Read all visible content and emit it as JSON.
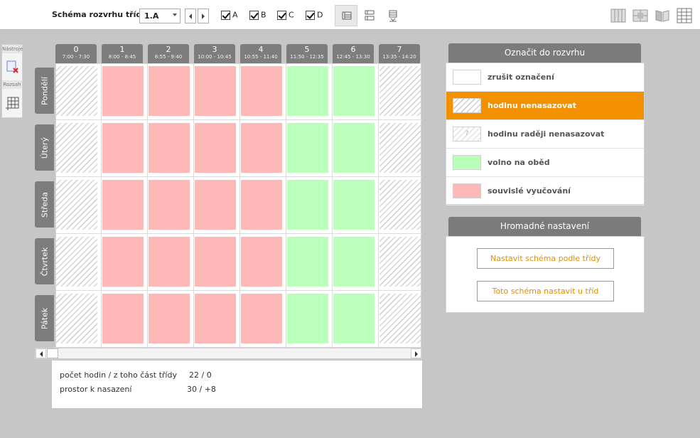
{
  "toolbar": {
    "label": "Schéma rozvrhu třídy:",
    "class_select": "1.A",
    "checks": [
      {
        "label": "A",
        "checked": true
      },
      {
        "label": "B",
        "checked": true
      },
      {
        "label": "C",
        "checked": true
      },
      {
        "label": "D",
        "checked": true
      }
    ]
  },
  "side": {
    "tools_label": "Nástroje",
    "range_label": "Rozsah"
  },
  "columns": [
    {
      "num": "0",
      "time": "7:00 - 7:30"
    },
    {
      "num": "1",
      "time": "8:00 - 8:45"
    },
    {
      "num": "2",
      "time": "8:55 - 9:40"
    },
    {
      "num": "3",
      "time": "10:00 - 10:45"
    },
    {
      "num": "4",
      "time": "10:55 - 11:40"
    },
    {
      "num": "5",
      "time": "11:50 - 12:35"
    },
    {
      "num": "6",
      "time": "12:45 - 13:30"
    },
    {
      "num": "7",
      "time": "13:35 - 14:20"
    }
  ],
  "days": [
    "Pondělí",
    "Úterý",
    "Středa",
    "Čtvrtek",
    "Pátek"
  ],
  "cell_pattern": [
    "hatch",
    "pink",
    "pink",
    "pink",
    "pink",
    "green",
    "green",
    "hatch"
  ],
  "stats": {
    "hours_label": "počet hodin / z toho část třídy",
    "hours_value": "22 / 0",
    "space_label": "prostor k nasazení",
    "space_value": "30 / +8"
  },
  "legend": {
    "title": "Označit do rozvrhu",
    "items": [
      {
        "label": "zrušit označení",
        "swatch": "white",
        "active": false
      },
      {
        "label": "hodinu nenasazovat",
        "swatch": "hatch",
        "active": true
      },
      {
        "label": "hodinu raději nenasazovat",
        "swatch": "hatchq",
        "active": false
      },
      {
        "label": "volno na oběd",
        "swatch": "green",
        "active": false
      },
      {
        "label": "souvislé vyučování",
        "swatch": "pink",
        "active": false
      }
    ]
  },
  "bulk": {
    "title": "Hromadné nastavení",
    "btn1": "Nastavit schéma podle třídy",
    "btn2": "Toto schéma nastavit u tříd"
  },
  "colors": {
    "accent": "#f39000",
    "header_gray": "#7b7b7b",
    "pink": "#ffb8b8",
    "green": "#baffba"
  }
}
